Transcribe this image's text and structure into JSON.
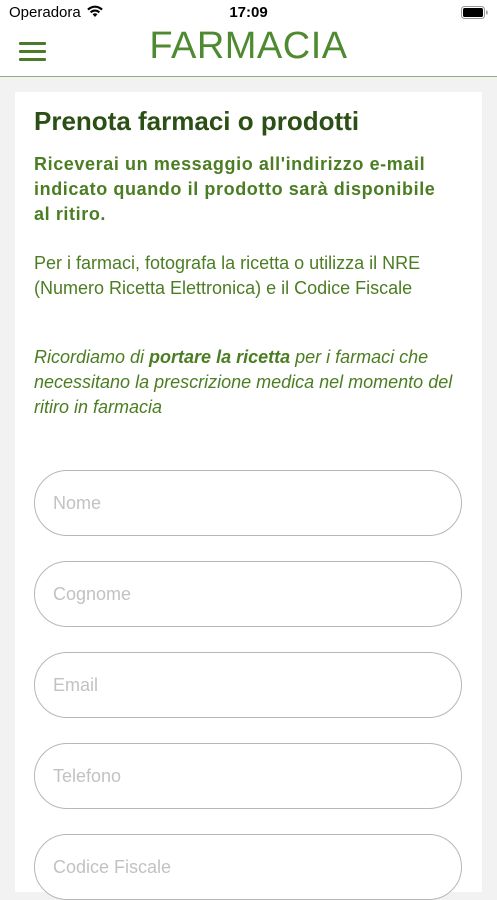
{
  "status_bar": {
    "carrier": "Operadora",
    "time": "17:09",
    "icons": [
      "wifi-icon",
      "battery-icon"
    ]
  },
  "header": {
    "title": "FARMACIA",
    "menu_icon": "hamburger-menu-icon"
  },
  "content": {
    "title": "Prenota farmaci o prodotti",
    "notice_bold": "Riceverai un messaggio all'indirizzo e-mail indicato quando il prodotto sarà disponibile al ritiro.",
    "notice_normal": "Per i farmaci, fotografa la ricetta o utilizza il NRE (Numero Ricetta Elettronica) e il Codice Fiscale",
    "notice_italic_before": "Ricordiamo di ",
    "notice_italic_strong": "portare la ricetta",
    "notice_italic_after": " per i farmaci che necessitano la prescrizione medica nel momento del ritiro in farmacia"
  },
  "form": {
    "fields": [
      {
        "placeholder": "Nome",
        "value": ""
      },
      {
        "placeholder": "Cognome",
        "value": ""
      },
      {
        "placeholder": "Email",
        "value": ""
      },
      {
        "placeholder": "Telefono",
        "value": ""
      },
      {
        "placeholder": "Codice Fiscale",
        "value": ""
      }
    ]
  },
  "colors": {
    "brand_green": "#4e8a2f",
    "title_green": "#2b4f14",
    "text_green": "#4b7d22",
    "field_border": "#b7b7b7",
    "placeholder": "#c2c2c2"
  }
}
